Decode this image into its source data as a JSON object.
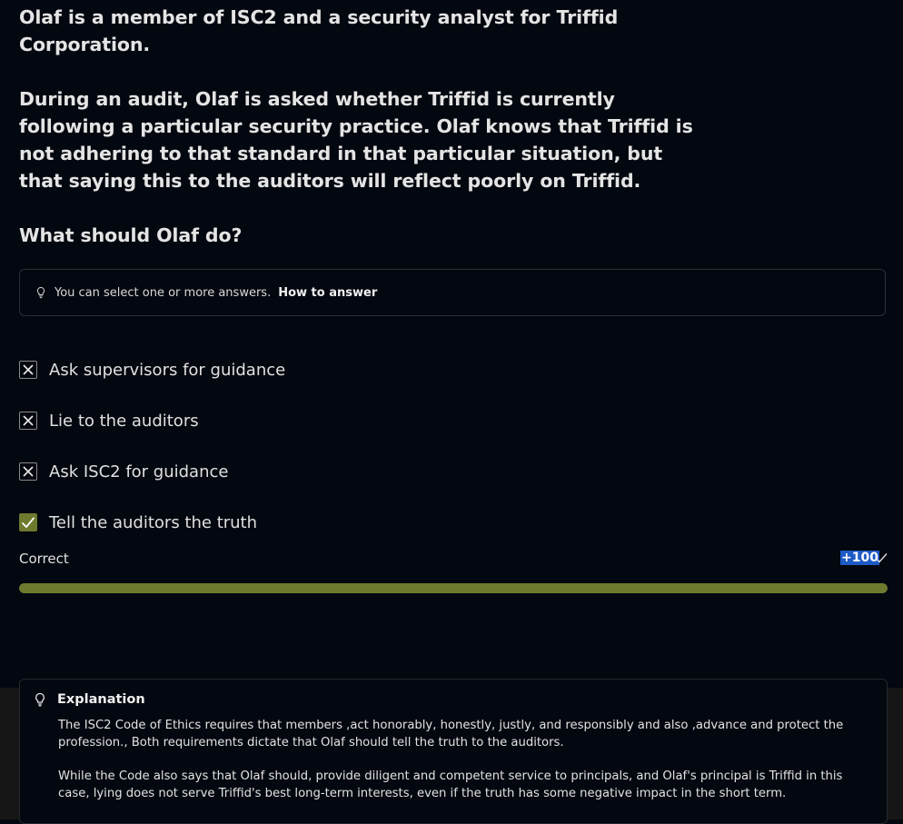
{
  "question": {
    "intro": "Olaf is a member of ISC2 and a security analyst for Triffid Corporation.",
    "scenario": "During an audit, Olaf is asked whether Triffid is currently following a particular security practice. Olaf knows that Triffid is not adhering to that standard in that particular situation, but that saying this to the auditors will reflect poorly on Triffid.",
    "prompt": "What should Olaf do?"
  },
  "hint": {
    "icon": "lightbulb-icon",
    "text": "You can select one or more answers.",
    "link": "How to answer"
  },
  "options": [
    {
      "label": "Ask supervisors for guidance",
      "state": "incorrect"
    },
    {
      "label": "Lie to the auditors",
      "state": "incorrect"
    },
    {
      "label": "Ask ISC2 for guidance",
      "state": "incorrect"
    },
    {
      "label": "Tell the auditors the truth",
      "state": "correct"
    }
  ],
  "result": {
    "label": "Correct",
    "points": "+100",
    "progress": 1.0,
    "accent_color": "#6e7a2e"
  },
  "explanation": {
    "title": "Explanation",
    "paragraphs": [
      "The ISC2 Code of Ethics requires that members ,act honorably, honestly, justly, and responsibly and also ,advance and protect the profession., Both requirements dictate that Olaf should tell the truth to the auditors.",
      "While the Code also says that Olaf should, provide diligent and competent service to principals, and Olaf's principal is Triffid in this case, lying does not serve Triffid's best long-term interests, even if the truth has some negative impact in the short term."
    ]
  }
}
